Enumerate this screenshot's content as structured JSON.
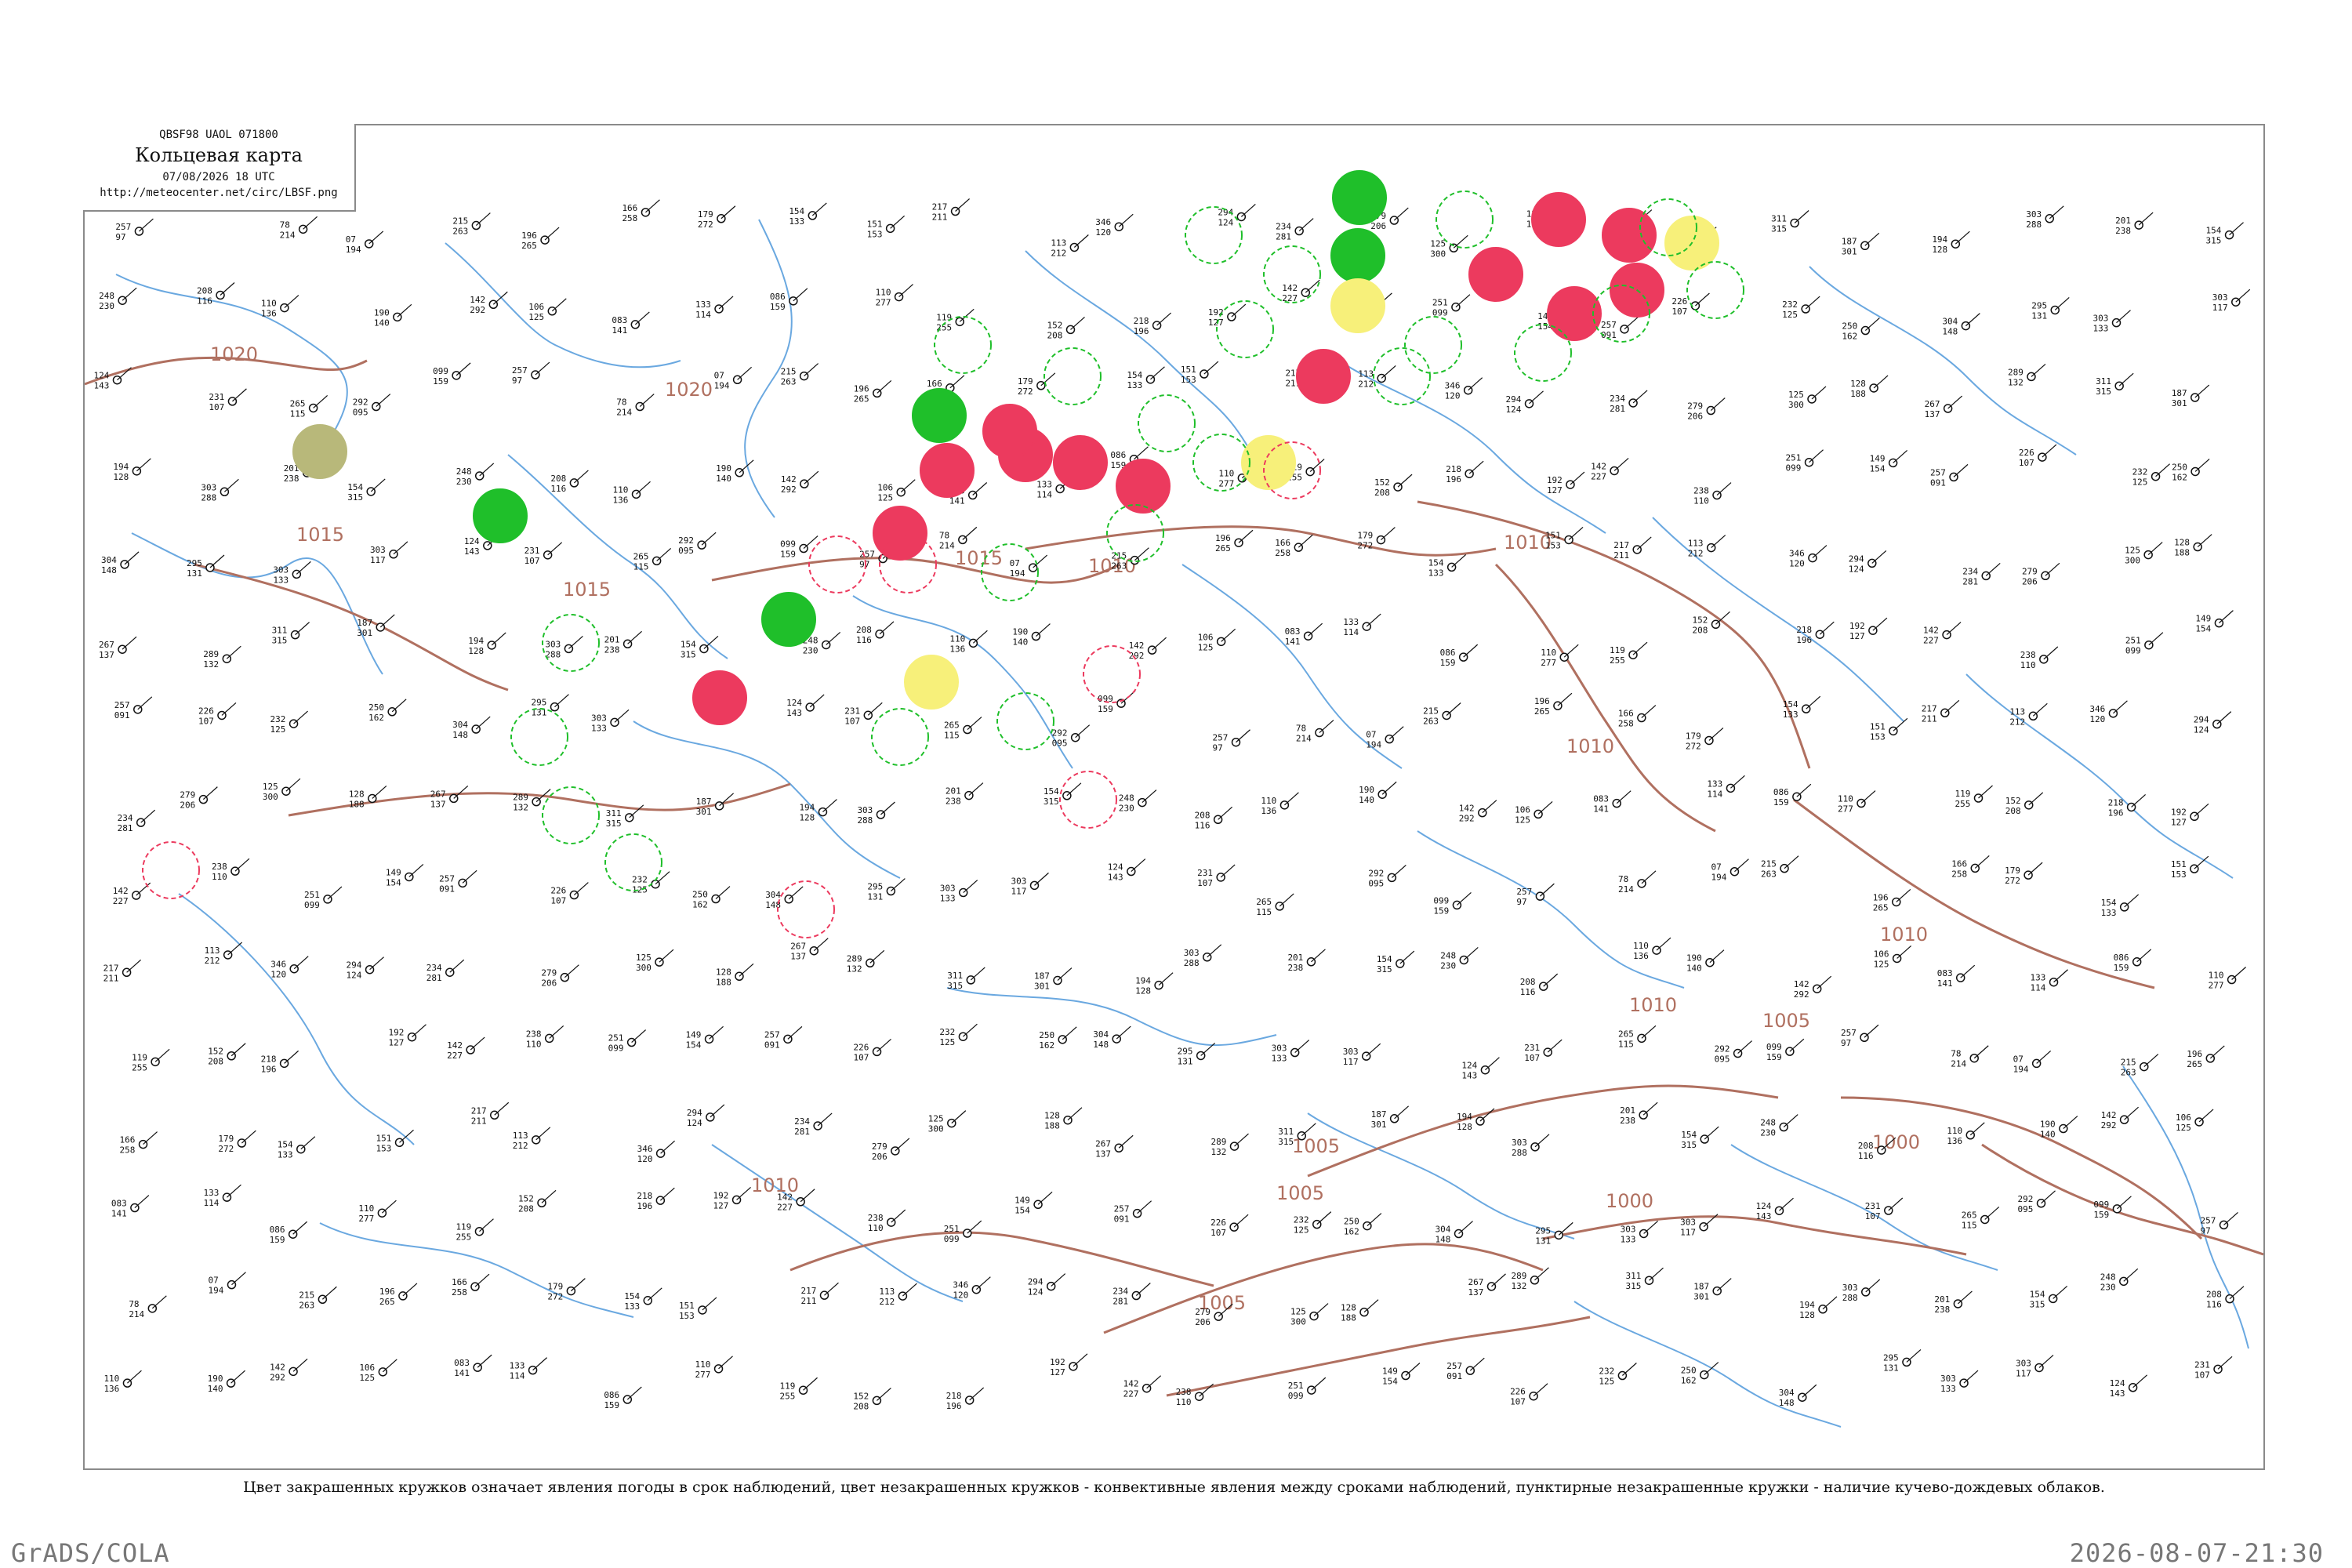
{
  "title_box": {
    "code_line": "QBSF98  UAOL  071800",
    "title": "Кольцевая карта",
    "date_line": "07/08/2026 18 UTC",
    "url": "http://meteocenter.net/circ/LBSF.png"
  },
  "legend": {
    "text": "Цвет закрашенных кружков означает явления погоды в срок наблюдений, цвет незакрашенных кружков - конвективные явления между сроками наблюдений, пунктирные незакрашенные кружки - наличие кучево-дождевых облаков."
  },
  "footer": {
    "left": "GrADS/COLA",
    "right": "2026-08-07-21:30"
  },
  "isobar_labels": [
    "1020",
    "1020",
    "1015",
    "1015",
    "1015",
    "1010",
    "1010",
    "1010",
    "1010",
    "1010",
    "1005",
    "1005",
    "1005",
    "1005",
    "1000",
    "1000",
    "1010"
  ],
  "station_labels": [
    "257",
    "97",
    "78",
    "214",
    "07",
    "194",
    "215",
    "263",
    "196",
    "265",
    "166",
    "258",
    "179",
    "272",
    "154",
    "133",
    "151",
    "153",
    "217",
    "211",
    "113",
    "212",
    "346",
    "120",
    "294",
    "124",
    "234",
    "281",
    "279",
    "206",
    "125",
    "300",
    "128",
    "188",
    "267",
    "137",
    "289",
    "132",
    "311",
    "315",
    "187",
    "301",
    "194",
    "128",
    "303",
    "288",
    "201",
    "238",
    "154",
    "315",
    "248",
    "230",
    "208",
    "116",
    "110",
    "136",
    "190",
    "140",
    "142",
    "292",
    "106",
    "125",
    "083",
    "141",
    "133",
    "114",
    "086",
    "159",
    "110",
    "277",
    "119",
    "255",
    "152",
    "208",
    "218",
    "196",
    "192",
    "127",
    "142",
    "227",
    "238",
    "110",
    "251",
    "099",
    "149",
    "154",
    "257",
    "091",
    "226",
    "107",
    "232",
    "125",
    "250",
    "162",
    "304",
    "148",
    "295",
    "131",
    "303",
    "133",
    "303",
    "117",
    "124",
    "143",
    "231",
    "107",
    "265",
    "115",
    "292",
    "095",
    "099",
    "159"
  ],
  "colors": {
    "green_fill": "#1fbf2a",
    "red_fill": "#ec3a5e",
    "yellow_fill": "#f7f07a",
    "olive_fill": "#b8b87a",
    "iso_color": "#b07060",
    "water_color": "#6aa8e0",
    "frame_color": "#8a8a8a"
  }
}
